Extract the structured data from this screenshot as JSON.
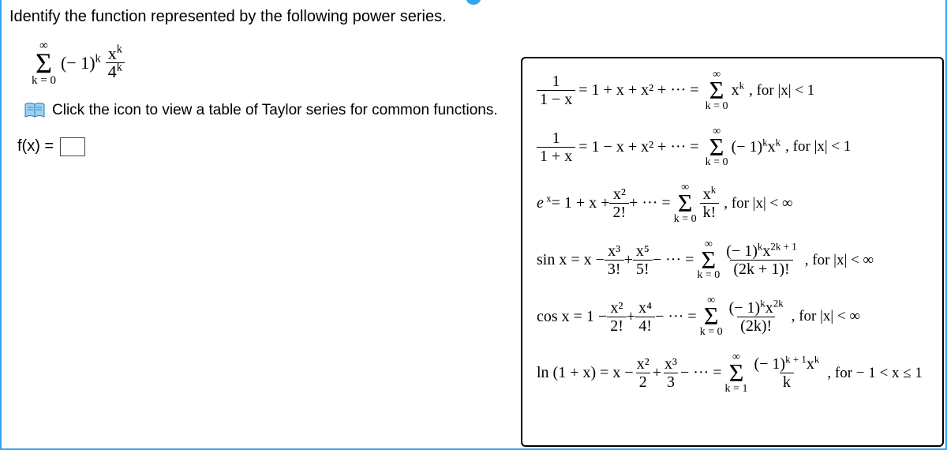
{
  "prompt": "Identify the function represented by the following power series.",
  "series": {
    "sum_top": "∞",
    "sum_bot": "k = 0",
    "term_left": "(− 1)",
    "term_left_sup": "k",
    "frac_num_base": "x",
    "frac_num_sup": "k",
    "frac_den_base": "4",
    "frac_den_sup": "k"
  },
  "link_text": "Click the icon to view a table of Taylor series for common functions.",
  "fx_label": "f(x) =",
  "popup": {
    "rows": [
      {
        "lhs_frac_num": "1",
        "lhs_frac_den": "1 − x",
        "expand": "= 1 + x + x² + ··· =",
        "sum_top": "∞",
        "sum_bot": "k = 0",
        "rhs_term": "x",
        "rhs_sup": "k",
        "cond": ", for |x| < 1"
      },
      {
        "lhs_frac_num": "1",
        "lhs_frac_den": "1 + x",
        "expand": "= 1 − x + x² + ··· =",
        "sum_top": "∞",
        "sum_bot": "k = 0",
        "rhs_pre": "(− 1)",
        "rhs_pre_sup": "k",
        "rhs_term": "x",
        "rhs_sup": "k",
        "cond": ", for |x| < 1"
      },
      {
        "lhs_plain": "e",
        "lhs_sup": " x",
        "lhs_after": " = 1 + x + ",
        "lhs_frac2_num": "x²",
        "lhs_frac2_den": "2!",
        "lhs_tail": " + ··· = ",
        "sum_top": "∞",
        "sum_bot": "k = 0",
        "rhs_frac_num": "x",
        "rhs_frac_num_sup": "k",
        "rhs_frac_den": "k!",
        "cond": ", for |x| < ∞"
      },
      {
        "lhs_func": "sin x = x − ",
        "f1n": "x³",
        "f1d": "3!",
        "mid1": " + ",
        "f2n": "x⁵",
        "f2d": "5!",
        "tail": " − ··· = ",
        "sum_top": "∞",
        "sum_bot": "k = 0",
        "rnum_pre": "(− 1)",
        "rnum_pre_sup": "k",
        "rnum_x": "x",
        "rnum_x_sup": "2k + 1",
        "rden": "(2k + 1)!",
        "cond": ", for |x| < ∞"
      },
      {
        "lhs_func": "cos x = 1 − ",
        "f1n": "x²",
        "f1d": "2!",
        "mid1": " + ",
        "f2n": "x⁴",
        "f2d": "4!",
        "tail": " − ··· = ",
        "sum_top": "∞",
        "sum_bot": "k = 0",
        "rnum_pre": "(− 1)",
        "rnum_pre_sup": "k",
        "rnum_x": "x",
        "rnum_x_sup": "2k",
        "rden": "(2k)!",
        "cond": ", for |x| < ∞"
      },
      {
        "lhs_func": "ln (1 + x) = x − ",
        "f1n": "x²",
        "f1d": "2",
        "mid1": " + ",
        "f2n": "x³",
        "f2d": "3",
        "tail": " − ··· = ",
        "sum_top": "∞",
        "sum_bot": "k = 1",
        "rnum_pre": "(− 1)",
        "rnum_pre_sup": "k + 1",
        "rnum_x": "x",
        "rnum_x_sup": "k",
        "rden": "k",
        "cond": ", for − 1 < x ≤ 1"
      }
    ]
  }
}
